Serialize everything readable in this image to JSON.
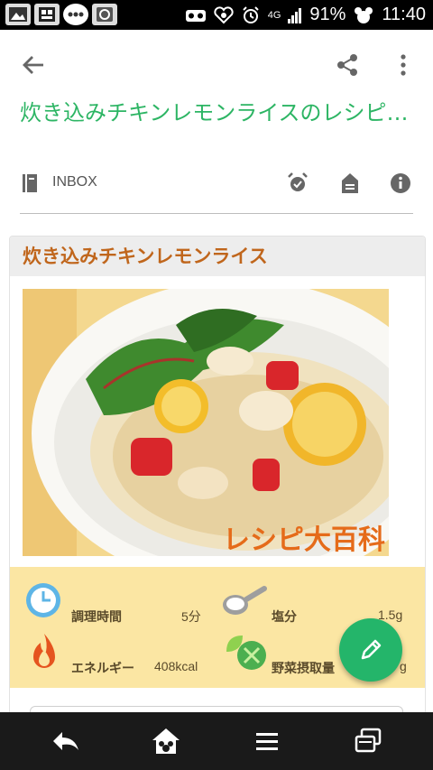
{
  "status_bar": {
    "network": "4G",
    "battery": "91%",
    "time": "11:40"
  },
  "toolbar": {
    "title": "炊き込みチキンレモンライスのレシピ…",
    "folder_label": "INBOX"
  },
  "recipe": {
    "title": "炊き込みチキンレモンライス",
    "watermark": "レシピ大百科",
    "info": {
      "time_label": "調理時間",
      "time_value": "5分",
      "salt_label": "塩分",
      "salt_value": "1.5g",
      "energy_label": "エネルギー",
      "energy_value": "408kcal",
      "veg_label": "野菜摂取量",
      "veg_value": "g"
    }
  },
  "colors": {
    "accent_green": "#2db564",
    "recipe_title": "#c0661c",
    "info_bg": "#fbe6a3",
    "fab": "#24b56a"
  },
  "icons": [
    "back-arrow-icon",
    "share-icon",
    "more-vert-icon",
    "book-icon",
    "alarm-icon",
    "label-icon",
    "info-icon",
    "clock-icon",
    "salt-spoon-icon",
    "flame-icon",
    "vegetable-icon",
    "pencil-icon",
    "nav-back-icon",
    "nav-home-icon",
    "nav-menu-icon",
    "nav-recent-icon"
  ]
}
